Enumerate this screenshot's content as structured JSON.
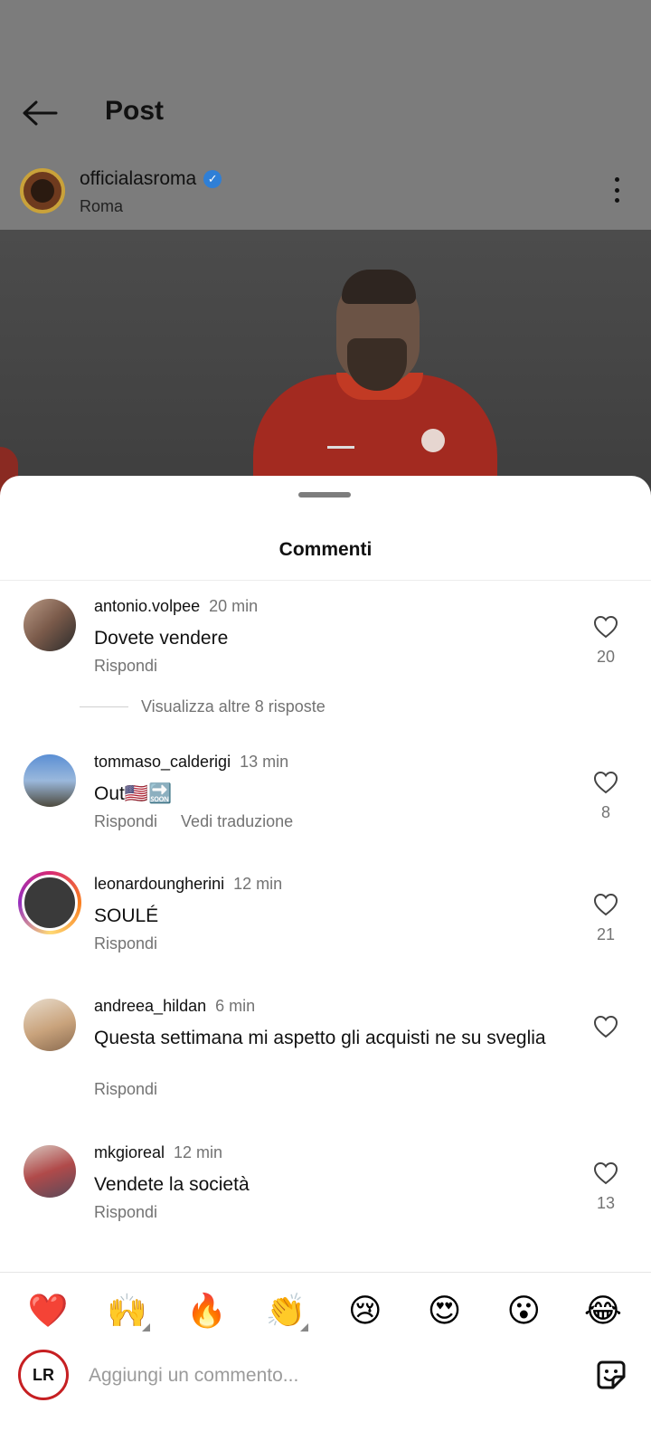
{
  "header": {
    "title": "Post"
  },
  "account": {
    "username": "officialasroma",
    "location": "Roma"
  },
  "sheet": {
    "title": "Commenti",
    "view_more_replies": "Visualizza altre 8 risposte"
  },
  "comments": [
    {
      "username": "antonio.volpee",
      "time": "20 min",
      "text": "Dovete vendere",
      "reply": "Rispondi",
      "translate": "",
      "likes": "20"
    },
    {
      "username": "tommaso_calderigi",
      "time": "13 min",
      "text": "Out🇺🇸🔜",
      "reply": "Rispondi",
      "translate": "Vedi traduzione",
      "likes": "8"
    },
    {
      "username": "leonardoungherini",
      "time": "12 min",
      "text": "SOULÉ",
      "reply": "Rispondi",
      "translate": "",
      "likes": "21"
    },
    {
      "username": "andreea_hildan",
      "time": "6 min",
      "text": "Questa settimana mi aspetto gli acquisti ne su sveglia",
      "reply": "Rispondi",
      "translate": "",
      "likes": ""
    },
    {
      "username": "mkgioreal",
      "time": "12 min",
      "text": "Vendete la società",
      "reply": "Rispondi",
      "translate": "",
      "likes": "13"
    }
  ],
  "quick_reactions": [
    "❤️",
    "🙌",
    "🔥",
    "👏",
    "😢",
    "😍",
    "😮",
    "😂"
  ],
  "compose": {
    "placeholder": "Aggiungi un commento...",
    "avatar_text": "LR"
  }
}
